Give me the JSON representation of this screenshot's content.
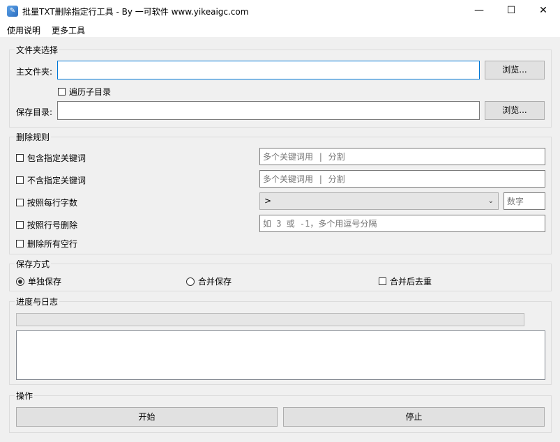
{
  "window": {
    "title": "批量TXT删除指定行工具 - By 一可软件 www.yikeaigc.com",
    "minimize_glyph": "—",
    "maximize_glyph": "☐",
    "close_glyph": "✕"
  },
  "menu": {
    "items": [
      "使用说明",
      "更多工具"
    ]
  },
  "folder_group": {
    "title": "文件夹选择",
    "main_label": "主文件夹:",
    "main_value": "",
    "browse_label": "浏览...",
    "traverse_label": "遍历子目录",
    "traverse_checked": false,
    "save_label": "保存目录:",
    "save_value": ""
  },
  "rules_group": {
    "title": "删除规则",
    "include_label": "包含指定关键词",
    "include_placeholder": "多个关键词用 | 分割",
    "exclude_label": "不含指定关键词",
    "exclude_placeholder": "多个关键词用 | 分割",
    "charcount_label": "按照每行字数",
    "charcount_operator": ">",
    "charcount_placeholder": "数字",
    "lineno_label": "按照行号删除",
    "lineno_placeholder": "如 3 或 -1，多个用逗号分隔",
    "empty_label": "删除所有空行"
  },
  "save_group": {
    "title": "保存方式",
    "separate_label": "单独保存",
    "merge_label": "合并保存",
    "dedupe_label": "合并后去重",
    "selected": "separate"
  },
  "progress_group": {
    "title": "进度与日志",
    "progress": 0,
    "log": ""
  },
  "action_group": {
    "title": "操作",
    "start_label": "开始",
    "stop_label": "停止"
  }
}
